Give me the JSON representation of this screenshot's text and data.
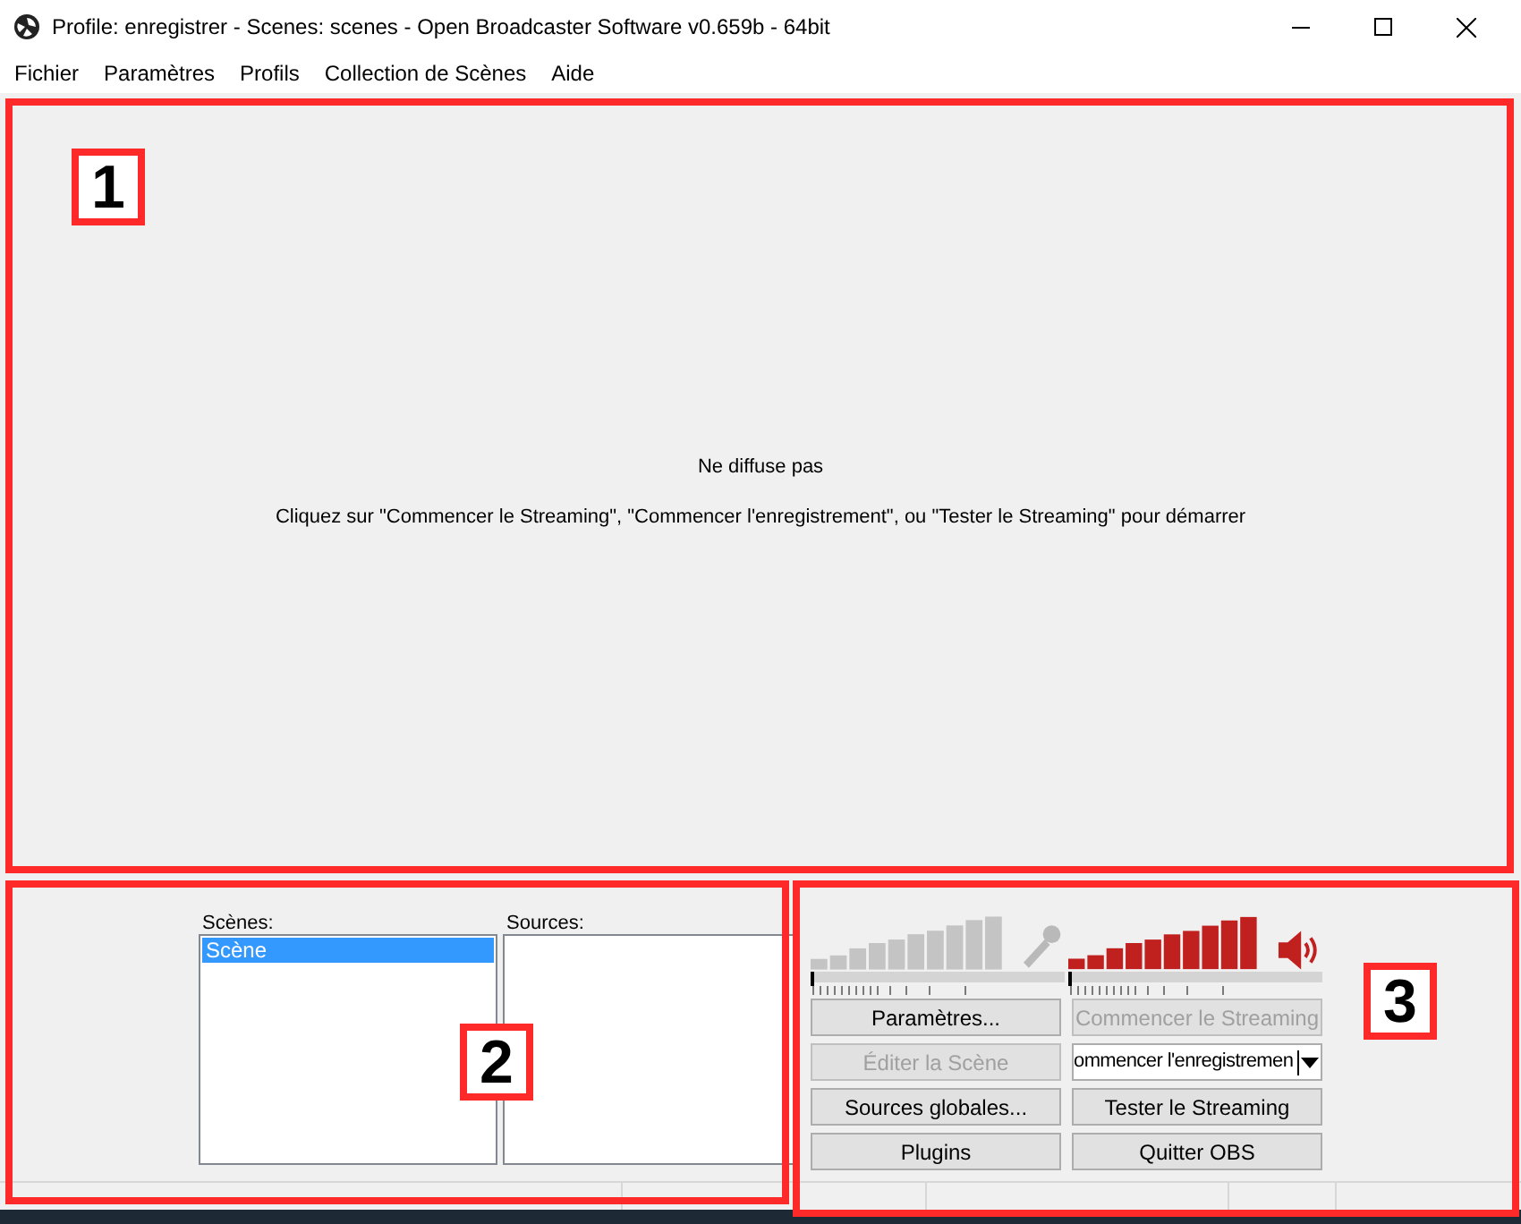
{
  "window": {
    "title": "Profile: enregistrer - Scenes: scenes - Open Broadcaster Software v0.659b - 64bit"
  },
  "menu": [
    "Fichier",
    "Paramètres",
    "Profils",
    "Collection de Scènes",
    "Aide"
  ],
  "preview": {
    "status": "Ne diffuse pas",
    "hint": "Cliquez sur \"Commencer le Streaming\", \"Commencer l'enregistrement\", ou \"Tester le Streaming\" pour démarrer"
  },
  "scenes": {
    "label": "Scènes:",
    "items": [
      {
        "label": "Scène",
        "selected": true
      }
    ]
  },
  "sources": {
    "label": "Sources:"
  },
  "meters": [
    {
      "kind": "microphone",
      "muted": true,
      "level": 0
    },
    {
      "kind": "speaker",
      "muted": false,
      "level": 0
    }
  ],
  "buttons": [
    {
      "label": "Paramètres...",
      "disabled": false,
      "kind": "button"
    },
    {
      "label": "Commencer le Streaming",
      "disabled": true,
      "kind": "button"
    },
    {
      "label": "Éditer la Scène",
      "disabled": true,
      "kind": "button"
    },
    {
      "label": "ommencer l'enregistremen",
      "disabled": false,
      "kind": "split"
    },
    {
      "label": "Sources globales...",
      "disabled": false,
      "kind": "button"
    },
    {
      "label": "Tester le Streaming",
      "disabled": false,
      "kind": "button"
    },
    {
      "label": "Plugins",
      "disabled": false,
      "kind": "button"
    },
    {
      "label": "Quitter OBS",
      "disabled": false,
      "kind": "button"
    }
  ],
  "callouts": [
    "1",
    "2",
    "3"
  ]
}
